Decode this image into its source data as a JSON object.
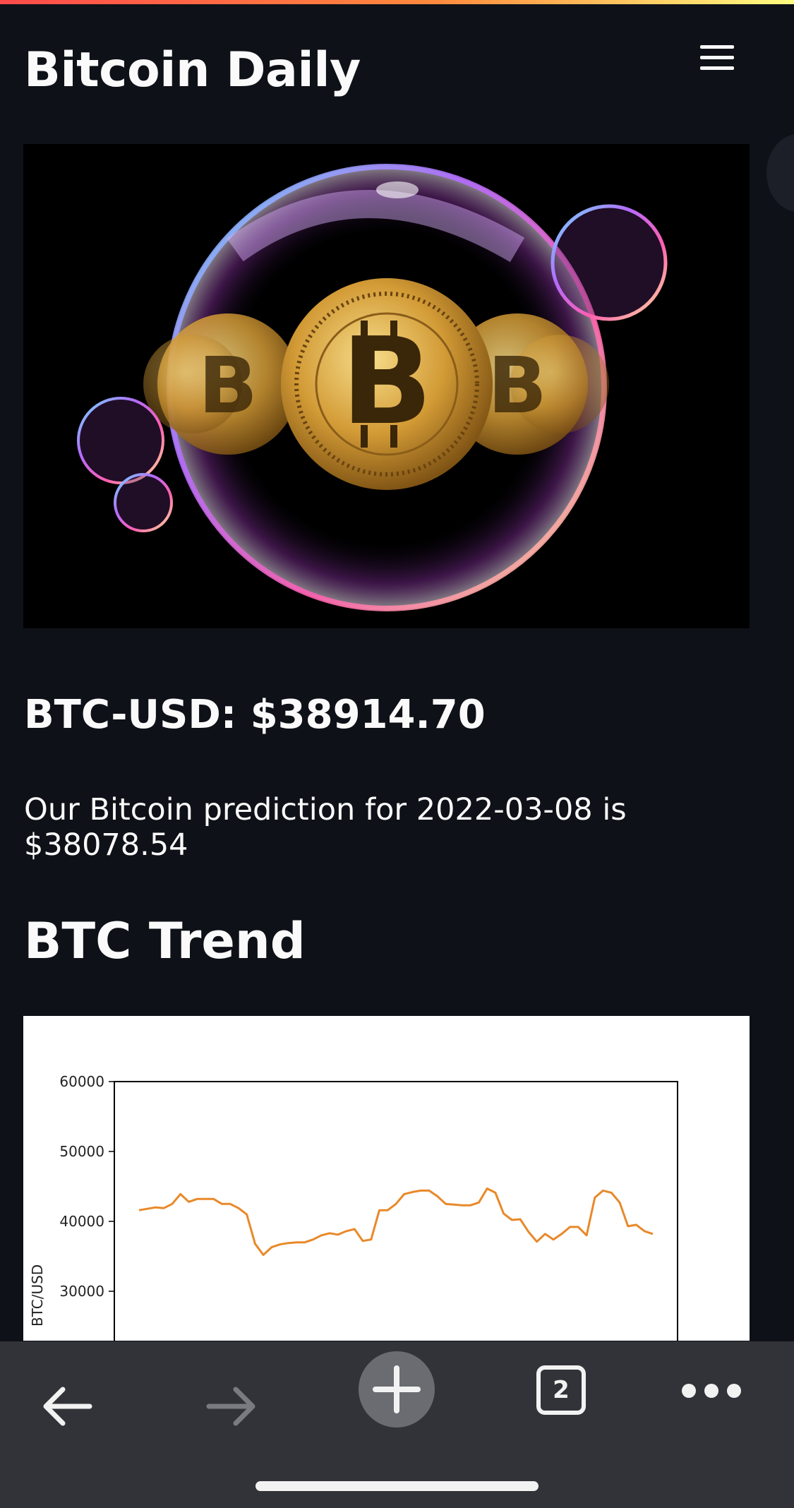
{
  "header": {
    "title": "Bitcoin Daily",
    "menu_icon": "hamburger-menu-icon"
  },
  "hero_image": {
    "alt": "Bitcoin coins inside a soap bubble"
  },
  "price": {
    "text": "BTC-USD: $38914.70"
  },
  "prediction": {
    "text": "Our Bitcoin prediction for 2022-03-08 is $38078.54"
  },
  "trend": {
    "title": "BTC Trend"
  },
  "chart_data": {
    "type": "line",
    "title": "",
    "xlabel": "",
    "ylabel": "BTC/USD",
    "ylim": [
      20000,
      60000
    ],
    "yticks": [
      "60000",
      "50000",
      "40000",
      "30000"
    ],
    "series": [
      {
        "color": "#e8892a",
        "values": [
          41600,
          41800,
          42000,
          41900,
          42500,
          43900,
          42800,
          43200,
          43200,
          43200,
          42500,
          42500,
          41900,
          41000,
          36800,
          35200,
          36300,
          36700,
          36900,
          37000,
          37000,
          37400,
          38000,
          38300,
          38100,
          38600,
          38900,
          37200,
          37400,
          41600,
          41600,
          42500,
          43900,
          44200,
          44400,
          44400,
          43600,
          42500,
          42400,
          42300,
          42300,
          42700,
          44700,
          44100,
          41100,
          40200,
          40300,
          38500,
          37100,
          38200,
          37400,
          38200,
          39200,
          39200,
          38000,
          43400,
          44400,
          44100,
          42700,
          39300,
          39500,
          38600,
          38200
        ]
      }
    ]
  },
  "navbar": {
    "back_icon": "back-arrow-icon",
    "forward_icon": "forward-arrow-icon",
    "new_tab_icon": "plus-icon",
    "tab_count": "2",
    "more_icon": "more-dots-icon"
  }
}
